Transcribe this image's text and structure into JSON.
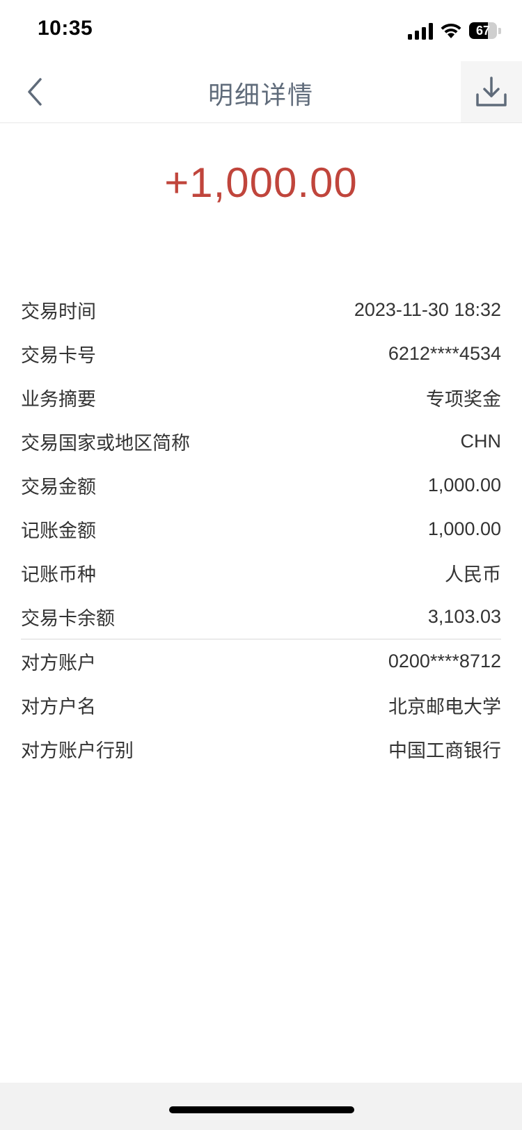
{
  "status_bar": {
    "time": "10:35",
    "battery": "67",
    "signal_icon": "signal-bars-icon",
    "wifi_icon": "wifi-icon"
  },
  "nav": {
    "title": "明细详情",
    "back_icon": "chevron-left-icon",
    "download_icon": "download-icon"
  },
  "amount": "+1,000.00",
  "colors": {
    "amount": "#c0453c",
    "title": "#5f6b7a",
    "text": "#333333"
  },
  "details_primary": [
    {
      "label": "交易时间",
      "value": "2023-11-30 18:32"
    },
    {
      "label": "交易卡号",
      "value": "6212****4534"
    },
    {
      "label": "业务摘要",
      "value": "专项奖金"
    },
    {
      "label": "交易国家或地区简称",
      "value": "CHN"
    },
    {
      "label": "交易金额",
      "value": "1,000.00"
    },
    {
      "label": "记账金额",
      "value": "1,000.00"
    },
    {
      "label": "记账币种",
      "value": "人民币"
    },
    {
      "label": "交易卡余额",
      "value": "3,103.03"
    }
  ],
  "details_counterparty": [
    {
      "label": "对方账户",
      "value": "0200****8712"
    },
    {
      "label": "对方户名",
      "value": "北京邮电大学"
    },
    {
      "label": "对方账户行别",
      "value": "中国工商银行"
    }
  ]
}
